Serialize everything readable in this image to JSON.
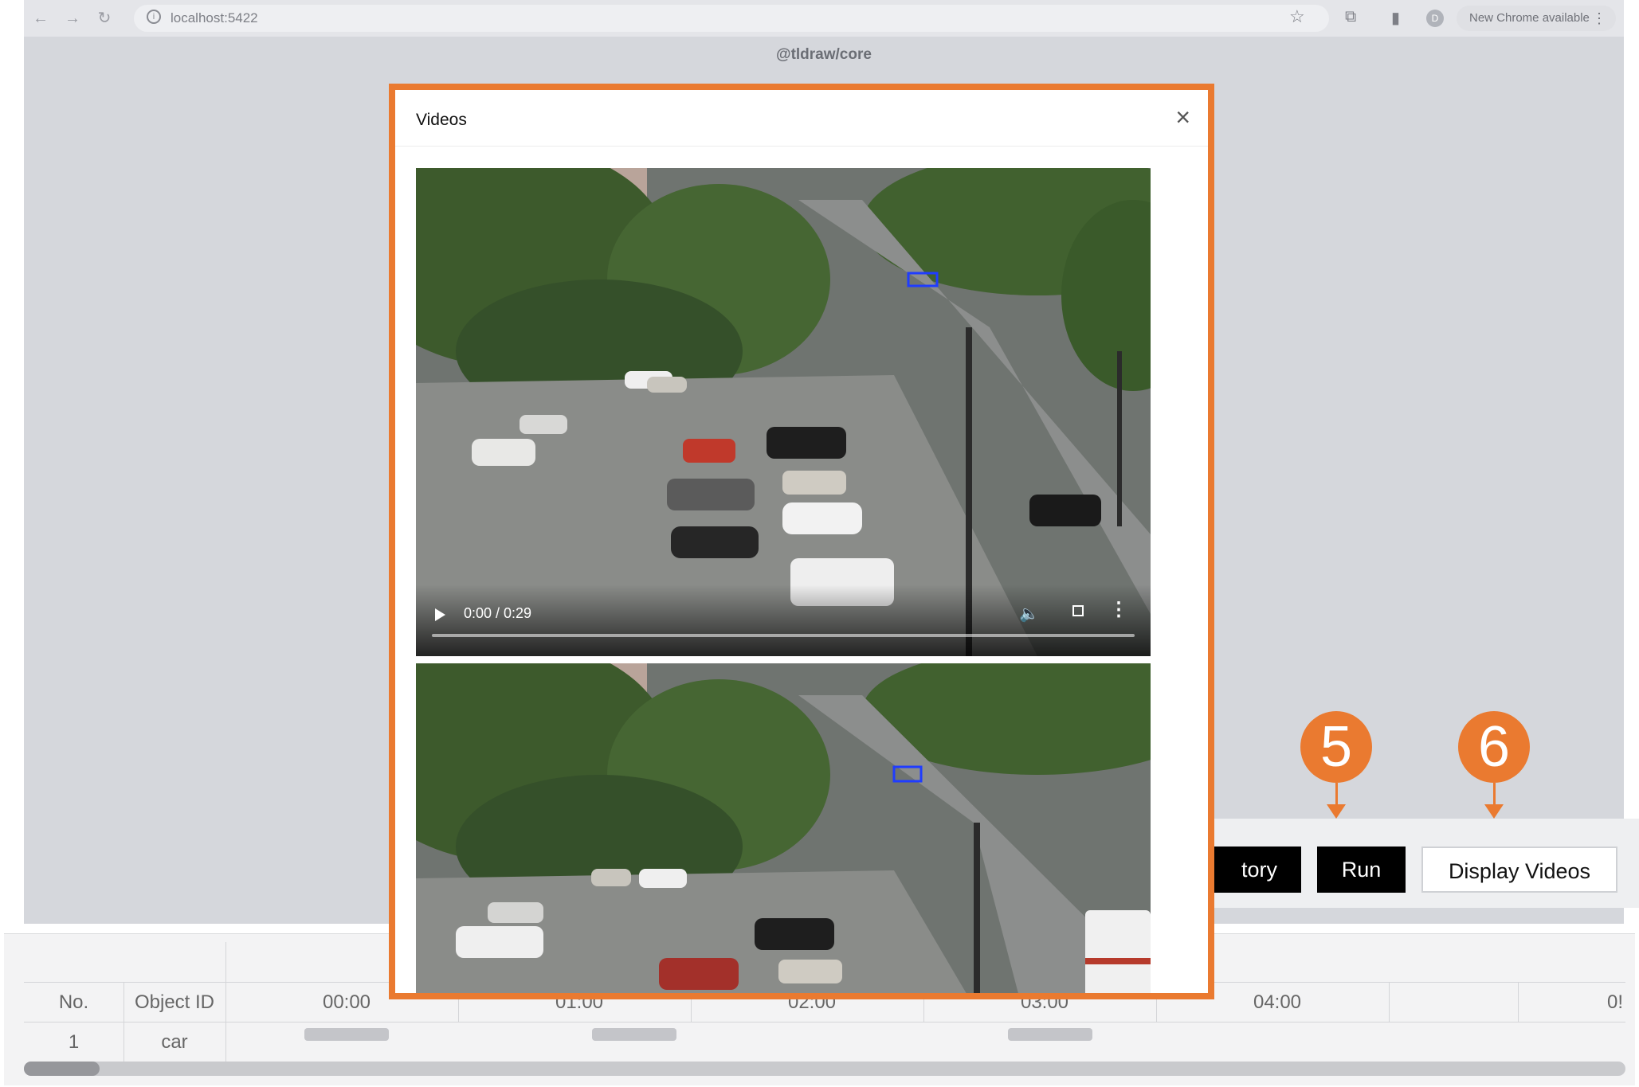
{
  "browser": {
    "url": "localhost:5422",
    "profile_initial": "D",
    "update_label": "New Chrome available",
    "page_title": "@tldraw/core"
  },
  "controls": {
    "history_label": "tory",
    "run_label": "Run",
    "display_label": "Display Videos",
    "step_badges": [
      "5",
      "6"
    ],
    "accent_color": "#ea7a30"
  },
  "table": {
    "headers": [
      "No.",
      "Object ID"
    ],
    "time_ticks": [
      "00:00",
      "01:00",
      "02:00",
      "03:00",
      "04:00",
      "0!"
    ],
    "rows": [
      {
        "no": "1",
        "object_id": "car"
      }
    ]
  },
  "modal": {
    "title": "Videos",
    "videos": [
      {
        "time": "0:00 / 0:29",
        "progress": 0
      },
      {
        "time": "",
        "progress": 0
      }
    ]
  }
}
